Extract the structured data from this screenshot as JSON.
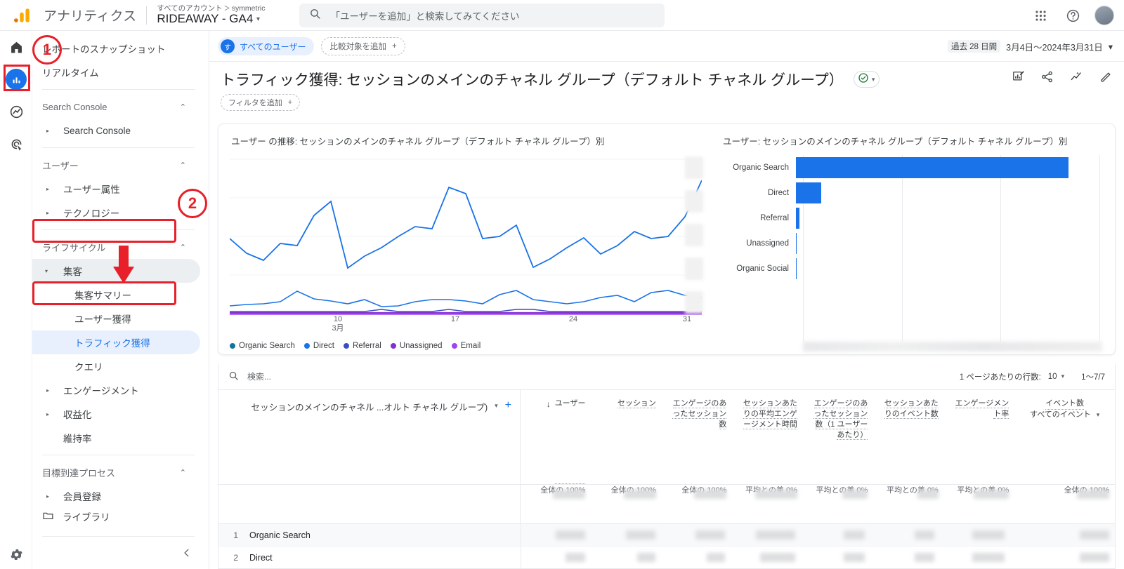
{
  "topbar": {
    "brand": "アナリティクス",
    "account_breadcrumb_prefix": "すべてのアカウント",
    "account_breadcrumb_sep": "＞",
    "account_breadcrumb_suffix": "symmetric",
    "property_name": "RIDEAWAY - GA4",
    "property_caret": "▾",
    "search_placeholder": "「ユーザーを追加」と検索してみてください",
    "icons": [
      "search-icon",
      "apps-grid-icon",
      "help-icon",
      "avatar"
    ]
  },
  "rail": {
    "items": [
      {
        "name": "home-icon",
        "label": "ホーム"
      },
      {
        "name": "reports-icon",
        "label": "レポート"
      },
      {
        "name": "explore-icon",
        "label": "探索"
      },
      {
        "name": "advertising-icon",
        "label": "広告"
      }
    ],
    "settings_label": "管理",
    "active_index": 1
  },
  "sidebar": {
    "items": [
      {
        "label": "レポートのスナップショット",
        "level": 1,
        "type": "link"
      },
      {
        "label": "リアルタイム",
        "level": 1,
        "type": "link"
      },
      {
        "type": "separator"
      },
      {
        "label": "Search Console",
        "level": 1,
        "type": "section",
        "chevron": "⌃"
      },
      {
        "label": "Search Console",
        "level": 2,
        "type": "expandable",
        "triangle": "▸"
      },
      {
        "type": "separator"
      },
      {
        "label": "ユーザー",
        "level": 1,
        "type": "section",
        "chevron": "⌃"
      },
      {
        "label": "ユーザー属性",
        "level": 2,
        "type": "expandable",
        "triangle": "▸"
      },
      {
        "label": "テクノロジー",
        "level": 2,
        "type": "expandable",
        "triangle": "▸"
      },
      {
        "type": "separator"
      },
      {
        "label": "ライフサイクル",
        "level": 1,
        "type": "section",
        "chevron": "⌃"
      },
      {
        "label": "集客",
        "level": 2,
        "type": "expanded",
        "triangle": "▾",
        "state": "greyed"
      },
      {
        "label": "集客サマリー",
        "level": 3,
        "type": "link"
      },
      {
        "label": "ユーザー獲得",
        "level": 3,
        "type": "link"
      },
      {
        "label": "トラフィック獲得",
        "level": 3,
        "type": "link",
        "state": "selected"
      },
      {
        "label": "クエリ",
        "level": 3,
        "type": "link"
      },
      {
        "label": "エンゲージメント",
        "level": 2,
        "type": "expandable",
        "triangle": "▸"
      },
      {
        "label": "収益化",
        "level": 2,
        "type": "expandable",
        "triangle": "▸"
      },
      {
        "label": "維持率",
        "level": 2,
        "type": "link"
      },
      {
        "type": "separator"
      },
      {
        "label": "目標到達プロセス",
        "level": 1,
        "type": "section",
        "chevron": "⌃"
      },
      {
        "label": "会員登録",
        "level": 2,
        "type": "expandable",
        "triangle": "▸"
      }
    ],
    "library_label": "ライブラリ",
    "library_icon": "folder-icon",
    "collapse_icon": "chevron-left-icon"
  },
  "filterbar": {
    "audience_chip": "すべてのユーザー",
    "audience_badge": "す",
    "add_comparison": "比較対象を追加",
    "add_comparison_plus": "+",
    "date_past_label": "過去 28 日間",
    "date_range": "3月4日〜2024年3月31日",
    "date_caret": "▾"
  },
  "page": {
    "title": "トラフィック獲得: セッションのメインのチャネル グループ（デフォルト チャネル グループ）",
    "ok_badge_icon": "check-circle-icon",
    "ok_badge_caret": "▾",
    "add_filter": "フィルタを追加",
    "add_filter_plus": "+",
    "actions": [
      {
        "name": "edit-report-icon",
        "label": "レポートを編集"
      },
      {
        "name": "share-icon",
        "label": "共有"
      },
      {
        "name": "insights-icon",
        "label": "インサイト"
      },
      {
        "name": "pencil-icon",
        "label": "カスタマイズ"
      }
    ]
  },
  "chart_data": [
    {
      "type": "line",
      "title": "ユーザー の推移: セッションのメインのチャネル グループ（デフォルト チャネル グループ）別",
      "xlabel": "",
      "ylabel": "",
      "grid": true,
      "legend_position": "bottom",
      "xtick_labels": [
        {
          "value": "10",
          "sub": "3月"
        },
        {
          "value": "17",
          "sub": ""
        },
        {
          "value": "24",
          "sub": ""
        },
        {
          "value": "31",
          "sub": ""
        }
      ],
      "x": [
        4,
        5,
        6,
        7,
        8,
        9,
        10,
        11,
        12,
        13,
        14,
        15,
        16,
        17,
        18,
        19,
        20,
        21,
        22,
        23,
        24,
        25,
        26,
        27,
        28,
        29,
        30,
        31
      ],
      "series": [
        {
          "name": "Organic Search",
          "color": "#1a73e8",
          "values": [
            46,
            39,
            35,
            43,
            42,
            58,
            66,
            31,
            37,
            41,
            47,
            52,
            51,
            75,
            72,
            50,
            51,
            57,
            34,
            38,
            44,
            49,
            41,
            45,
            54,
            50,
            51,
            62,
            79
          ]
        },
        {
          "name": "Direct",
          "color": "#1a73e8",
          "values": [
            4,
            5,
            5,
            6,
            11,
            7,
            6,
            5,
            7,
            4,
            4,
            6,
            7,
            7,
            6,
            5,
            9,
            11,
            7,
            6,
            5,
            6,
            8,
            9,
            6,
            10,
            11,
            9,
            8
          ]
        },
        {
          "name": "Referral",
          "color": "#3b4cca",
          "values": [
            1,
            1,
            1,
            1,
            1,
            1,
            1,
            1,
            1,
            2,
            1,
            1,
            1,
            2,
            1,
            1,
            1,
            2,
            2,
            1,
            1,
            1,
            1,
            1,
            1,
            1,
            1,
            1,
            1
          ]
        },
        {
          "name": "Unassigned",
          "color": "#8430ce",
          "values": [
            1,
            1,
            1,
            1,
            1,
            1,
            1,
            1,
            1,
            1,
            1,
            1,
            1,
            1,
            1,
            1,
            1,
            1,
            1,
            1,
            1,
            1,
            1,
            1,
            1,
            1,
            1,
            1,
            1
          ]
        },
        {
          "name": "Email",
          "color": "#a142f4",
          "values": [
            0,
            0,
            0,
            0,
            0,
            0,
            0,
            0,
            0,
            0,
            0,
            0,
            0,
            0,
            0,
            0,
            0,
            0,
            0,
            0,
            0,
            0,
            0,
            0,
            0,
            0,
            0,
            0,
            0
          ]
        }
      ]
    },
    {
      "type": "bar",
      "orientation": "horizontal",
      "title": "ユーザー: セッションのメインのチャネル グループ（デフォルト チャネル グループ）別",
      "categories": [
        "Organic Search",
        "Direct",
        "Referral",
        "Unassigned",
        "Organic Social"
      ],
      "values": [
        100,
        9.2,
        1.3,
        0.35,
        0.35
      ],
      "bar_color": "#1a73e8",
      "grid": true,
      "gridlines_pct": [
        0,
        33,
        66,
        99
      ],
      "xlabel": "",
      "ylabel": ""
    }
  ],
  "table": {
    "search_placeholder": "検索...",
    "search_icon": "search-icon",
    "rows_per_page_label": "1 ページあたりの行数:",
    "rows_per_page_value": "10",
    "rows_per_page_caret": "▾",
    "range_label": "1〜7/7",
    "dimension_header": "セッションのメインのチャネル ...オルト チャネル グループ)",
    "dimension_caret": "▾",
    "dimension_plus": "+",
    "sort_arrow": "↓",
    "metric_headers": [
      "ユーザー",
      "セッション",
      "エンゲージのあったセッション数",
      "セッションあたりの平均エンゲージメント時間",
      "エンゲージのあったセッション数（1 ユーザーあたり）",
      "セッションあたりのイベント数",
      "エンゲージメント率"
    ],
    "last_metric_header_line1": "イベント数",
    "last_metric_header_line2": "すべてのイベント",
    "last_metric_caret": "▾",
    "summary_percents": [
      "全体の 100%",
      "全体の 100%",
      "全体の 100%",
      "平均との差 0%",
      "平均との差 0%",
      "平均との差 0%",
      "平均との差 0%",
      "全体の 100%"
    ],
    "rows": [
      {
        "rank": "1",
        "name": "Organic Search"
      },
      {
        "rank": "2",
        "name": "Direct"
      }
    ]
  },
  "annotations": [
    {
      "id": "1",
      "type": "circle",
      "label": "1"
    },
    {
      "id": "2",
      "type": "circle",
      "label": "2"
    }
  ]
}
